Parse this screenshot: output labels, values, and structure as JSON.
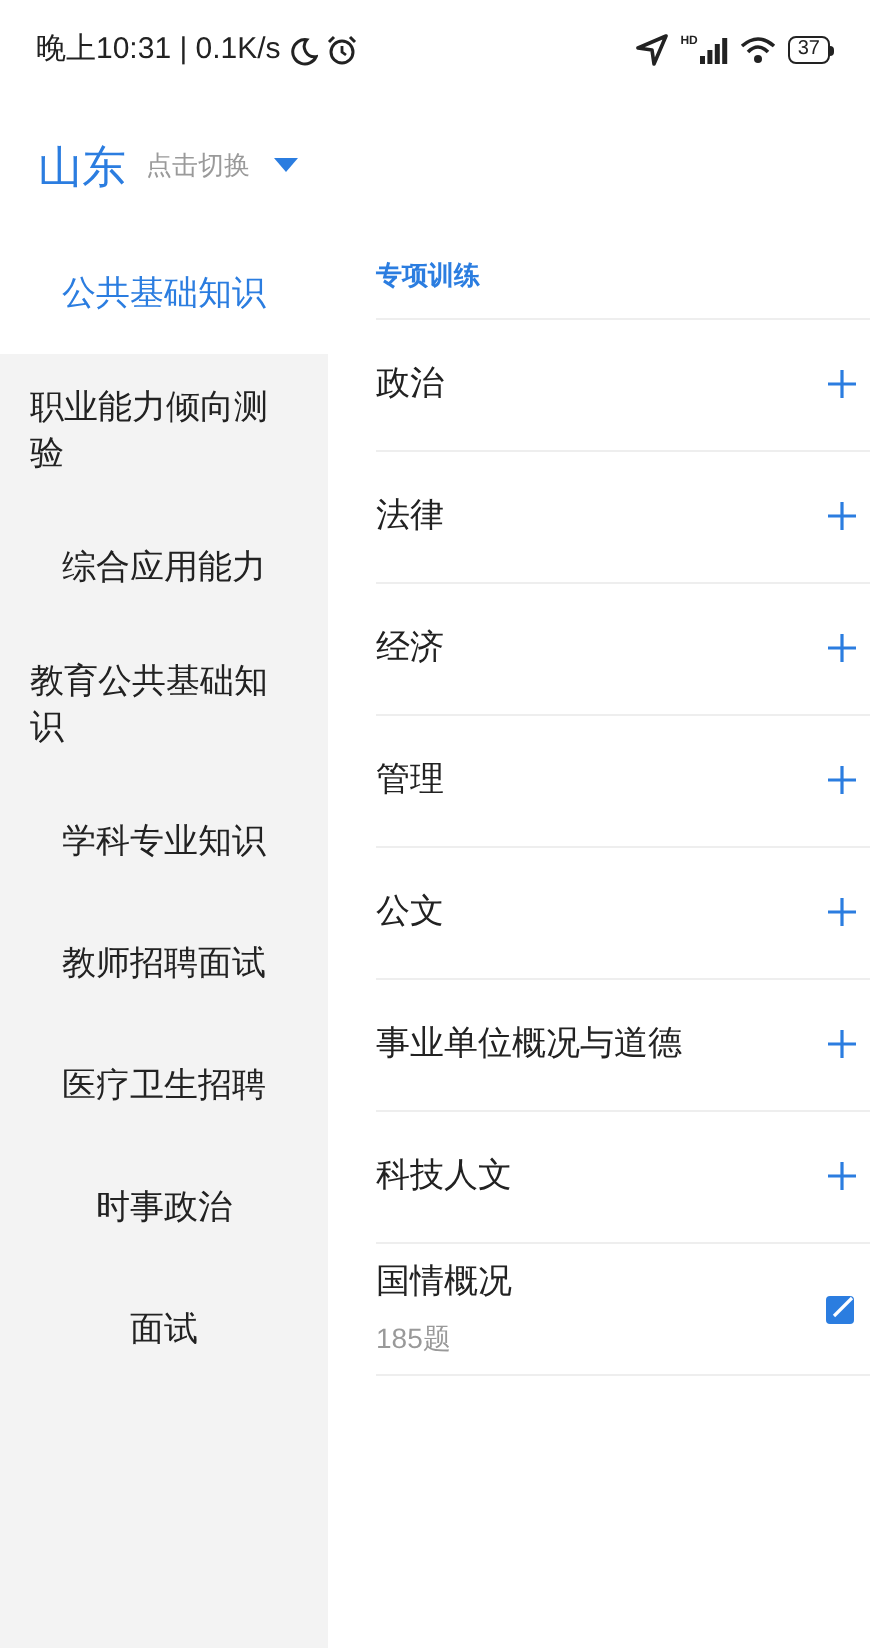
{
  "status_bar": {
    "time": "晚上10:31 | 0.1K/s",
    "network_badge": "HD",
    "battery": "37"
  },
  "header": {
    "region": "山东",
    "hint": "点击切换"
  },
  "sidebar": {
    "items": [
      {
        "label": "公共基础知识",
        "selected": true
      },
      {
        "label": "职业能力倾向测验",
        "selected": false
      },
      {
        "label": "综合应用能力",
        "selected": false
      },
      {
        "label": "教育公共基础知识",
        "selected": false
      },
      {
        "label": "学科专业知识",
        "selected": false
      },
      {
        "label": "教师招聘面试",
        "selected": false
      },
      {
        "label": "医疗卫生招聘",
        "selected": false
      },
      {
        "label": "时事政治",
        "selected": false
      },
      {
        "label": "面试",
        "selected": false
      }
    ]
  },
  "content": {
    "section_title": "专项训练",
    "topics": [
      {
        "kind": "add",
        "name": "政治"
      },
      {
        "kind": "add",
        "name": "法律"
      },
      {
        "kind": "add",
        "name": "经济"
      },
      {
        "kind": "add",
        "name": "管理"
      },
      {
        "kind": "add",
        "name": "公文"
      },
      {
        "kind": "add",
        "name": "事业单位概况与道德"
      },
      {
        "kind": "add",
        "name": "科技人文"
      },
      {
        "kind": "edit",
        "name": "国情概况",
        "count": "185题"
      }
    ]
  }
}
